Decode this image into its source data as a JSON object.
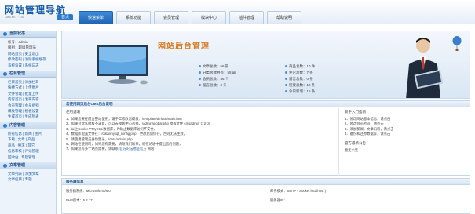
{
  "logo": {
    "title": "网站管理导航",
    "subtitle": "CMS.NET · 100",
    "badge": "首页"
  },
  "nav_tabs": [
    "快速菜单",
    "系统功能",
    "会员管理",
    "模块中心",
    "插件管理",
    "帮助说明"
  ],
  "sidebar": {
    "sections": [
      {
        "title": "当前状态",
        "rows": [
          "帐号：admin",
          "级别：超级管理员",
          "网站首页 | 安全退出",
          "修改密码 | 清除系统缓存",
          "系统设置 | 系统日志"
        ]
      },
      {
        "title": "栏目管理",
        "rows": [
          "栏目首页 | 添加栏目",
          "快捷方式 | 上传图片",
          "文件管理 | 批量上传",
          "内容首页 | 发布内容",
          "会员管理 | 会员组别",
          "模板管理 | 模板设置",
          "生成首页 | 生成列表"
        ]
      },
      {
        "title": "内容管理",
        "rows": [
          "所有信息 | 新闻 | 图片",
          "下载 | 文章 | 产品",
          "商品 | 供求 | 其它",
          "信息审核 | 评论管理",
          "回收站 | 专题管理"
        ]
      },
      {
        "title": "文章管理",
        "rows": [
          "文章列表 | 添加文章",
          "文章栏目 | 专题"
        ]
      }
    ]
  },
  "banner": {
    "title": "网站后台管理",
    "stats_col1": [
      "文章总数：56 篇",
      "分类总数共有：58 篇",
      "会员总数：46 个",
      "留言总数：0 条"
    ],
    "stats_col2": [
      "商品总数：10 件",
      "评论总数：7 条",
      "留言总数：0 条",
      "链接总数：12 条",
      "今日新增：15 条"
    ]
  },
  "guide_panel": {
    "title": "您使用网页后台CMS后台说明",
    "left_title": "使用说明",
    "left_lines": [
      "1、如果您要在前台整站使用，请手工修改您模板：/template/default/main.htm",
      "2、如果对默认模板不满意，可以去模板中心选择，/admin/global.php 模板文件 cmsadmin 自定义",
      "3、以上Cookie中MySQL数据库，为防止数据库访问不安全，",
      "4、数据库配置文件在：/data/mysql_config.php，更改后请保存，否则无法生效，",
      "5、请使用管理员身份登录，/data/admin.php",
      "6、网站在使用时，如果您有需要，请与我们联系，或在论坛中提出您的问题，",
      "7、如果您有多个站点需要，请联系",
      "   官方论坛地址官方",
      "   网站"
    ],
    "right_title": "新手入门指南",
    "right_lines": [
      "1、修改网站基本信息，请点击",
      "2、修改会员密码，请点击",
      "3、添加新闻，文章内容，请点击",
      "4、备份和还原数据库，请点击"
    ],
    "notice_title": "官方最新公告",
    "notice_text": "暂无公告"
  },
  "server_panel": {
    "title": "服务器信息",
    "row1_left": "服务器系统：Microsoft IIS/6.0",
    "row1_right": "邮件模式：SMTP ( Socket localhost )",
    "row2_left": "PHP版本：5.2.17",
    "row2_right": "服务器IP："
  },
  "colors": {
    "accent": "#1e63b2",
    "stat_value": "#c8441a",
    "title_orange": "#d8781e"
  }
}
